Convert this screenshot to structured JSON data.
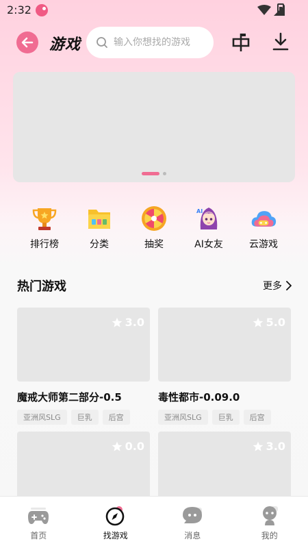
{
  "status_bar": {
    "time": "2:32"
  },
  "header": {
    "title": "游戏",
    "search_placeholder": "输入你想找的游戏"
  },
  "categories": [
    {
      "label": "排行榜",
      "icon": "trophy-icon"
    },
    {
      "label": "分类",
      "icon": "folder-icon"
    },
    {
      "label": "抽奖",
      "icon": "lottery-wheel-icon"
    },
    {
      "label": "AI女友",
      "icon": "ai-girl-avatar-icon"
    },
    {
      "label": "云游戏",
      "icon": "cloud-game-icon"
    }
  ],
  "hot_games": {
    "title": "热门游戏",
    "more_label": "更多",
    "items": [
      {
        "name": "魔戒大师第二部分-0.5",
        "rating": "3.0",
        "tags": [
          "亚洲风SLG",
          "巨乳",
          "后宫"
        ]
      },
      {
        "name": "毒性都市-0.09.0",
        "rating": "5.0",
        "tags": [
          "亚洲风SLG",
          "巨乳",
          "后宫"
        ]
      },
      {
        "name": "",
        "rating": "0.0",
        "tags": []
      },
      {
        "name": "",
        "rating": "3.0",
        "tags": []
      }
    ]
  },
  "bottom_nav": [
    {
      "label": "首页",
      "icon": "gamepad-icon",
      "active": false
    },
    {
      "label": "找游戏",
      "icon": "compass-icon",
      "active": true
    },
    {
      "label": "消息",
      "icon": "chat-bubble-icon",
      "active": false
    },
    {
      "label": "我的",
      "icon": "user-icon",
      "active": false
    }
  ],
  "colors": {
    "accent": "#f06c92",
    "placeholder": "#e6e6e6"
  }
}
